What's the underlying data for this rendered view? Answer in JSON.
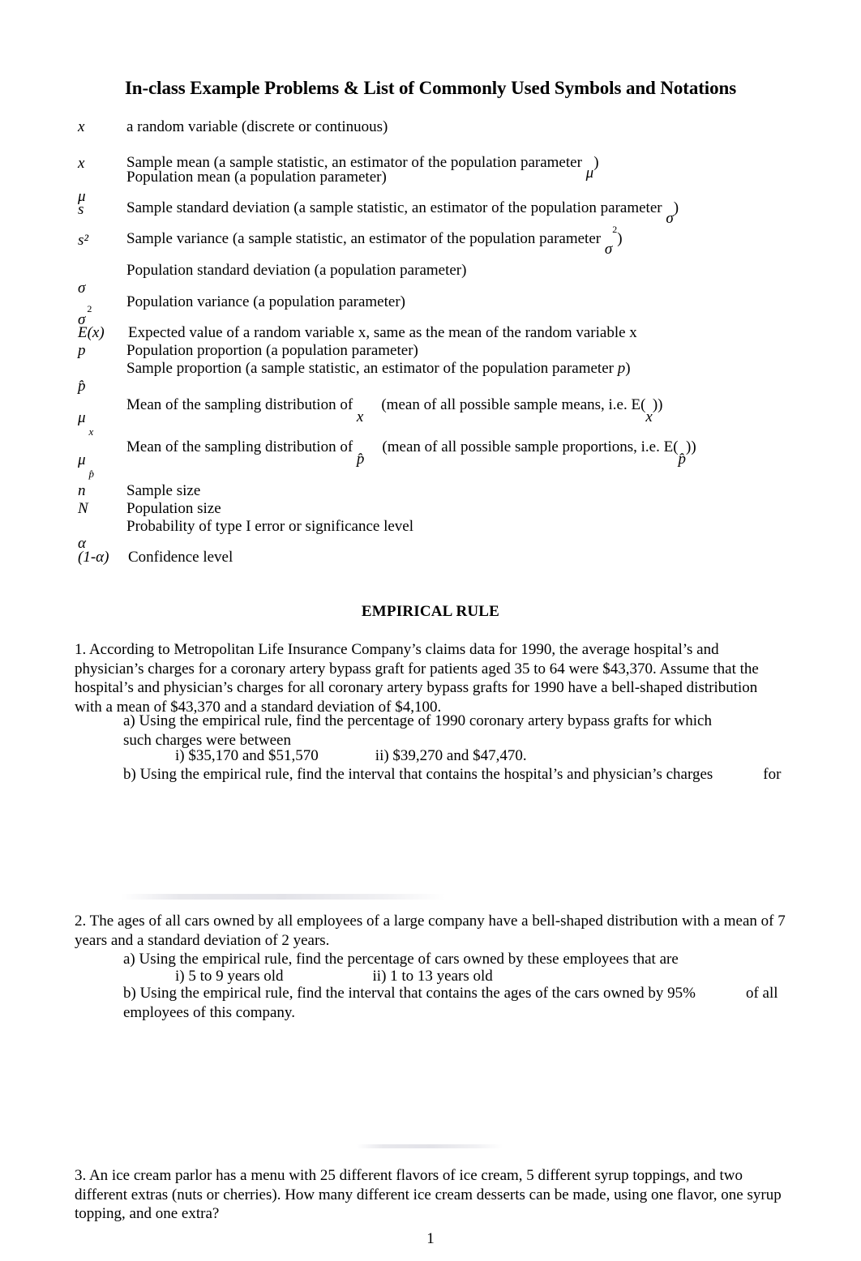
{
  "document": {
    "title": "In-class Example Problems & List of Commonly Used Symbols and Notations",
    "page_number": "1"
  },
  "symbols": {
    "rows": [
      {
        "key": "x",
        "desc": "a random variable (discrete or continuous)"
      },
      {
        "key": "x",
        "desc_before": "Sample mean (a sample statistic, an estimator of the population parameter ",
        "inline_symbol": "μ",
        "desc_after": ")"
      },
      {
        "key": "μ",
        "desc": "Population mean (a population parameter)"
      },
      {
        "key": "s",
        "desc_before": "Sample standard deviation (a sample statistic, an estimator of  the population parameter ",
        "inline_symbol": "σ",
        "desc_after": ")"
      },
      {
        "key": "s²",
        "desc_before": "Sample variance (a sample statistic, an estimator of the population parameter ",
        "inline_symbol": "σ",
        "inline_sup": "2",
        "desc_after": ")"
      },
      {
        "key": "σ",
        "desc": "Population standard deviation (a population parameter)"
      },
      {
        "key": "σ",
        "key_sup": "2",
        "desc": "Population variance (a population parameter)"
      },
      {
        "key": "E(x)",
        "desc": "Expected value of a random variable x, same as the mean of the random variable x"
      },
      {
        "key": "p",
        "desc": "Population proportion (a population parameter)"
      },
      {
        "key": "p̂",
        "desc_before": "Sample proportion (a sample statistic, an estimator of the population parameter ",
        "inline_symbol": "p",
        "desc_after": ")"
      },
      {
        "key": "μ",
        "key_sub": "x",
        "desc_before": "Mean of the sampling distribution of ",
        "inline_symbol": "x",
        "desc_mid": "(mean of all possible sample means, i.e. E(",
        "inline_symbol2": "x",
        "desc_after": "))"
      },
      {
        "key": "μ",
        "key_sub": "p̂",
        "desc_before": "Mean of the sampling distribution of ",
        "inline_symbol": "p̂",
        "desc_mid": "(mean of all possible sample proportions, i.e. E(",
        "inline_symbol2": "p̂",
        "desc_after": "))"
      },
      {
        "key": "n",
        "desc": "Sample size"
      },
      {
        "key": "N",
        "desc": "Population size"
      },
      {
        "key": "α",
        "desc": "Probability of type I error or significance level"
      },
      {
        "key": "(1-α)",
        "desc": "Confidence level"
      }
    ]
  },
  "sections": {
    "empirical_rule_heading": "EMPIRICAL RULE"
  },
  "problems": [
    {
      "id": "1",
      "body": "1. According to Metropolitan Life Insurance Company’s claims data for 1990, the average hospital’s and physician’s charges for a coronary artery bypass graft for patients aged 35 to 64 were $43,370. Assume that the hospital’s and physician’s charges for all coronary artery bypass grafts for 1990 have a bell-shaped distribution with a mean of $43,370 and a standard deviation of $4,100.",
      "part_a": "a) Using the empirical rule, find the percentage of 1990 coronary artery bypass grafts for which",
      "part_a_tail": "such charges were between",
      "roman_i": "i) $35,170 and $51,570",
      "roman_ii": "ii) $39,270 and $47,470.",
      "part_b": "b) Using the empirical rule, find the interval that contains the hospital’s and physician’s charges",
      "part_b_tail": "for"
    },
    {
      "id": "2",
      "body": "2. The ages of all cars owned by all employees of a large company have a bell-shaped distribution with a mean of 7 years and a standard deviation of 2 years.",
      "part_a": "a) Using the empirical rule, find the percentage of cars owned by these employees that are",
      "roman_i": "i) 5 to 9 years old",
      "roman_ii": "ii) 1 to 13 years old",
      "part_b": "b) Using the empirical rule, find the interval that contains the ages of the cars owned by 95%",
      "part_b_tail": "of all employees of this company."
    },
    {
      "id": "3",
      "body": "3.  An ice cream parlor has a menu with 25 different flavors of ice cream, 5 different syrup toppings, and two different extras (nuts or cherries).  How many different ice cream desserts can be made, using one flavor, one syrup topping, and one extra?"
    }
  ]
}
